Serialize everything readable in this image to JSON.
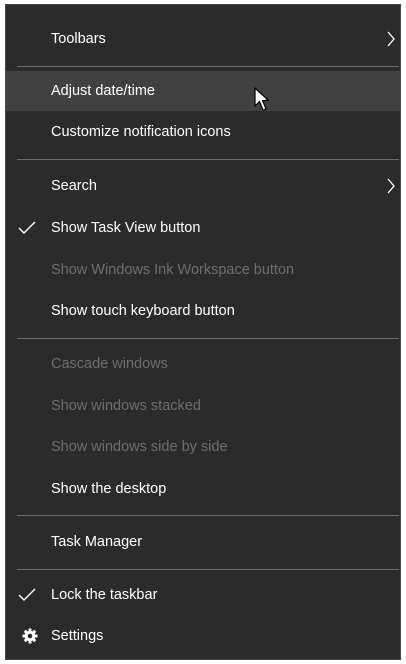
{
  "menu": {
    "toolbars": "Toolbars",
    "adjust_datetime": "Adjust date/time",
    "customize_icons": "Customize notification icons",
    "search": "Search",
    "show_task_view": "Show Task View button",
    "show_ink_workspace": "Show Windows Ink Workspace button",
    "show_touch_keyboard": "Show touch keyboard button",
    "cascade": "Cascade windows",
    "stacked": "Show windows stacked",
    "side_by_side": "Show windows side by side",
    "show_desktop": "Show the desktop",
    "task_manager": "Task Manager",
    "lock_taskbar": "Lock the taskbar",
    "settings": "Settings"
  },
  "state": {
    "hovered_item": "Adjust date/time",
    "checked": [
      "Show Task View button",
      "Lock the taskbar"
    ],
    "disabled": [
      "Show Windows Ink Workspace button",
      "Cascade windows",
      "Show windows stacked",
      "Show windows side by side"
    ]
  },
  "colors": {
    "menu_background": "#2b2b2b",
    "hover_background": "#414141",
    "text": "#ffffff",
    "disabled_text": "#6d6d6d",
    "separator": "#6b6b6b"
  },
  "icons": {
    "submenu": "chevron-right-icon",
    "check": "checkmark-icon",
    "settings": "gear-icon",
    "cursor": "mouse-pointer-icon"
  }
}
